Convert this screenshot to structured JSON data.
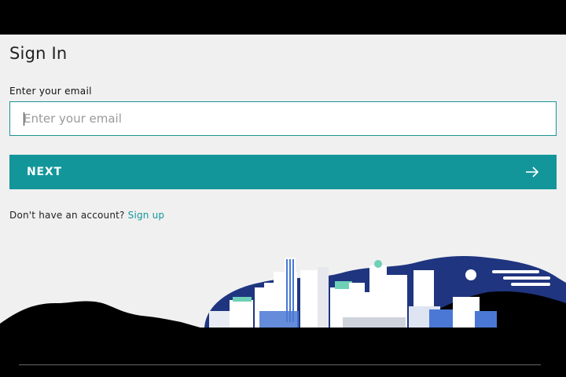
{
  "signin": {
    "title": "Sign In",
    "email_label": "Enter your email",
    "email_placeholder": "Enter your email",
    "email_value": "",
    "next_label": "NEXT",
    "no_account_text": "Don't have an account?",
    "signup_link": "Sign up"
  },
  "colors": {
    "accent": "#13969a",
    "top_bar": "#000000",
    "illustration_sky": "#1f3580",
    "illustration_green": "#6fd0b8",
    "illustration_blue": "#4a78d4",
    "background": "#f0f0f0"
  },
  "icons": {
    "next_arrow": "arrow-right-icon",
    "illustration": "city-skyline-illustration"
  }
}
